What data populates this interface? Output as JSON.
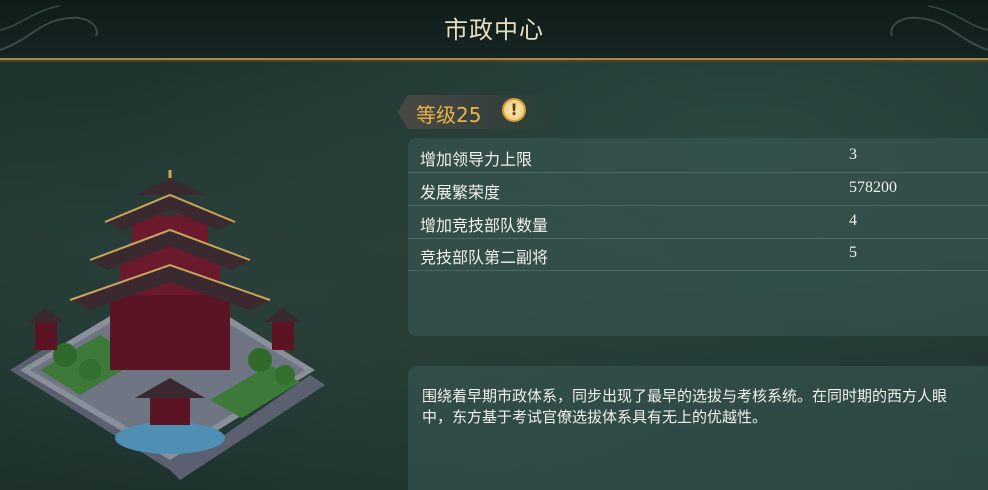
{
  "title": "市政中心",
  "level": {
    "label": "等级25",
    "info_icon": "exclamation-icon"
  },
  "stats": [
    {
      "label": "增加领导力上限",
      "value": "3"
    },
    {
      "label": "发展繁荣度",
      "value": "578200"
    },
    {
      "label": "增加竞技部队数量",
      "value": "4"
    },
    {
      "label": "竞技部队第二副将",
      "value": "5"
    }
  ],
  "description": "围绕着早期市政体系，同步出现了最早的选拔与考核系统。在同时期的西方人眼中，东方基于考试官僚选拔体系具有无上的优越性。",
  "colors": {
    "accent_gold": "#a58a4c",
    "level_text": "#e9b34a",
    "panel": "#3c5a56"
  }
}
